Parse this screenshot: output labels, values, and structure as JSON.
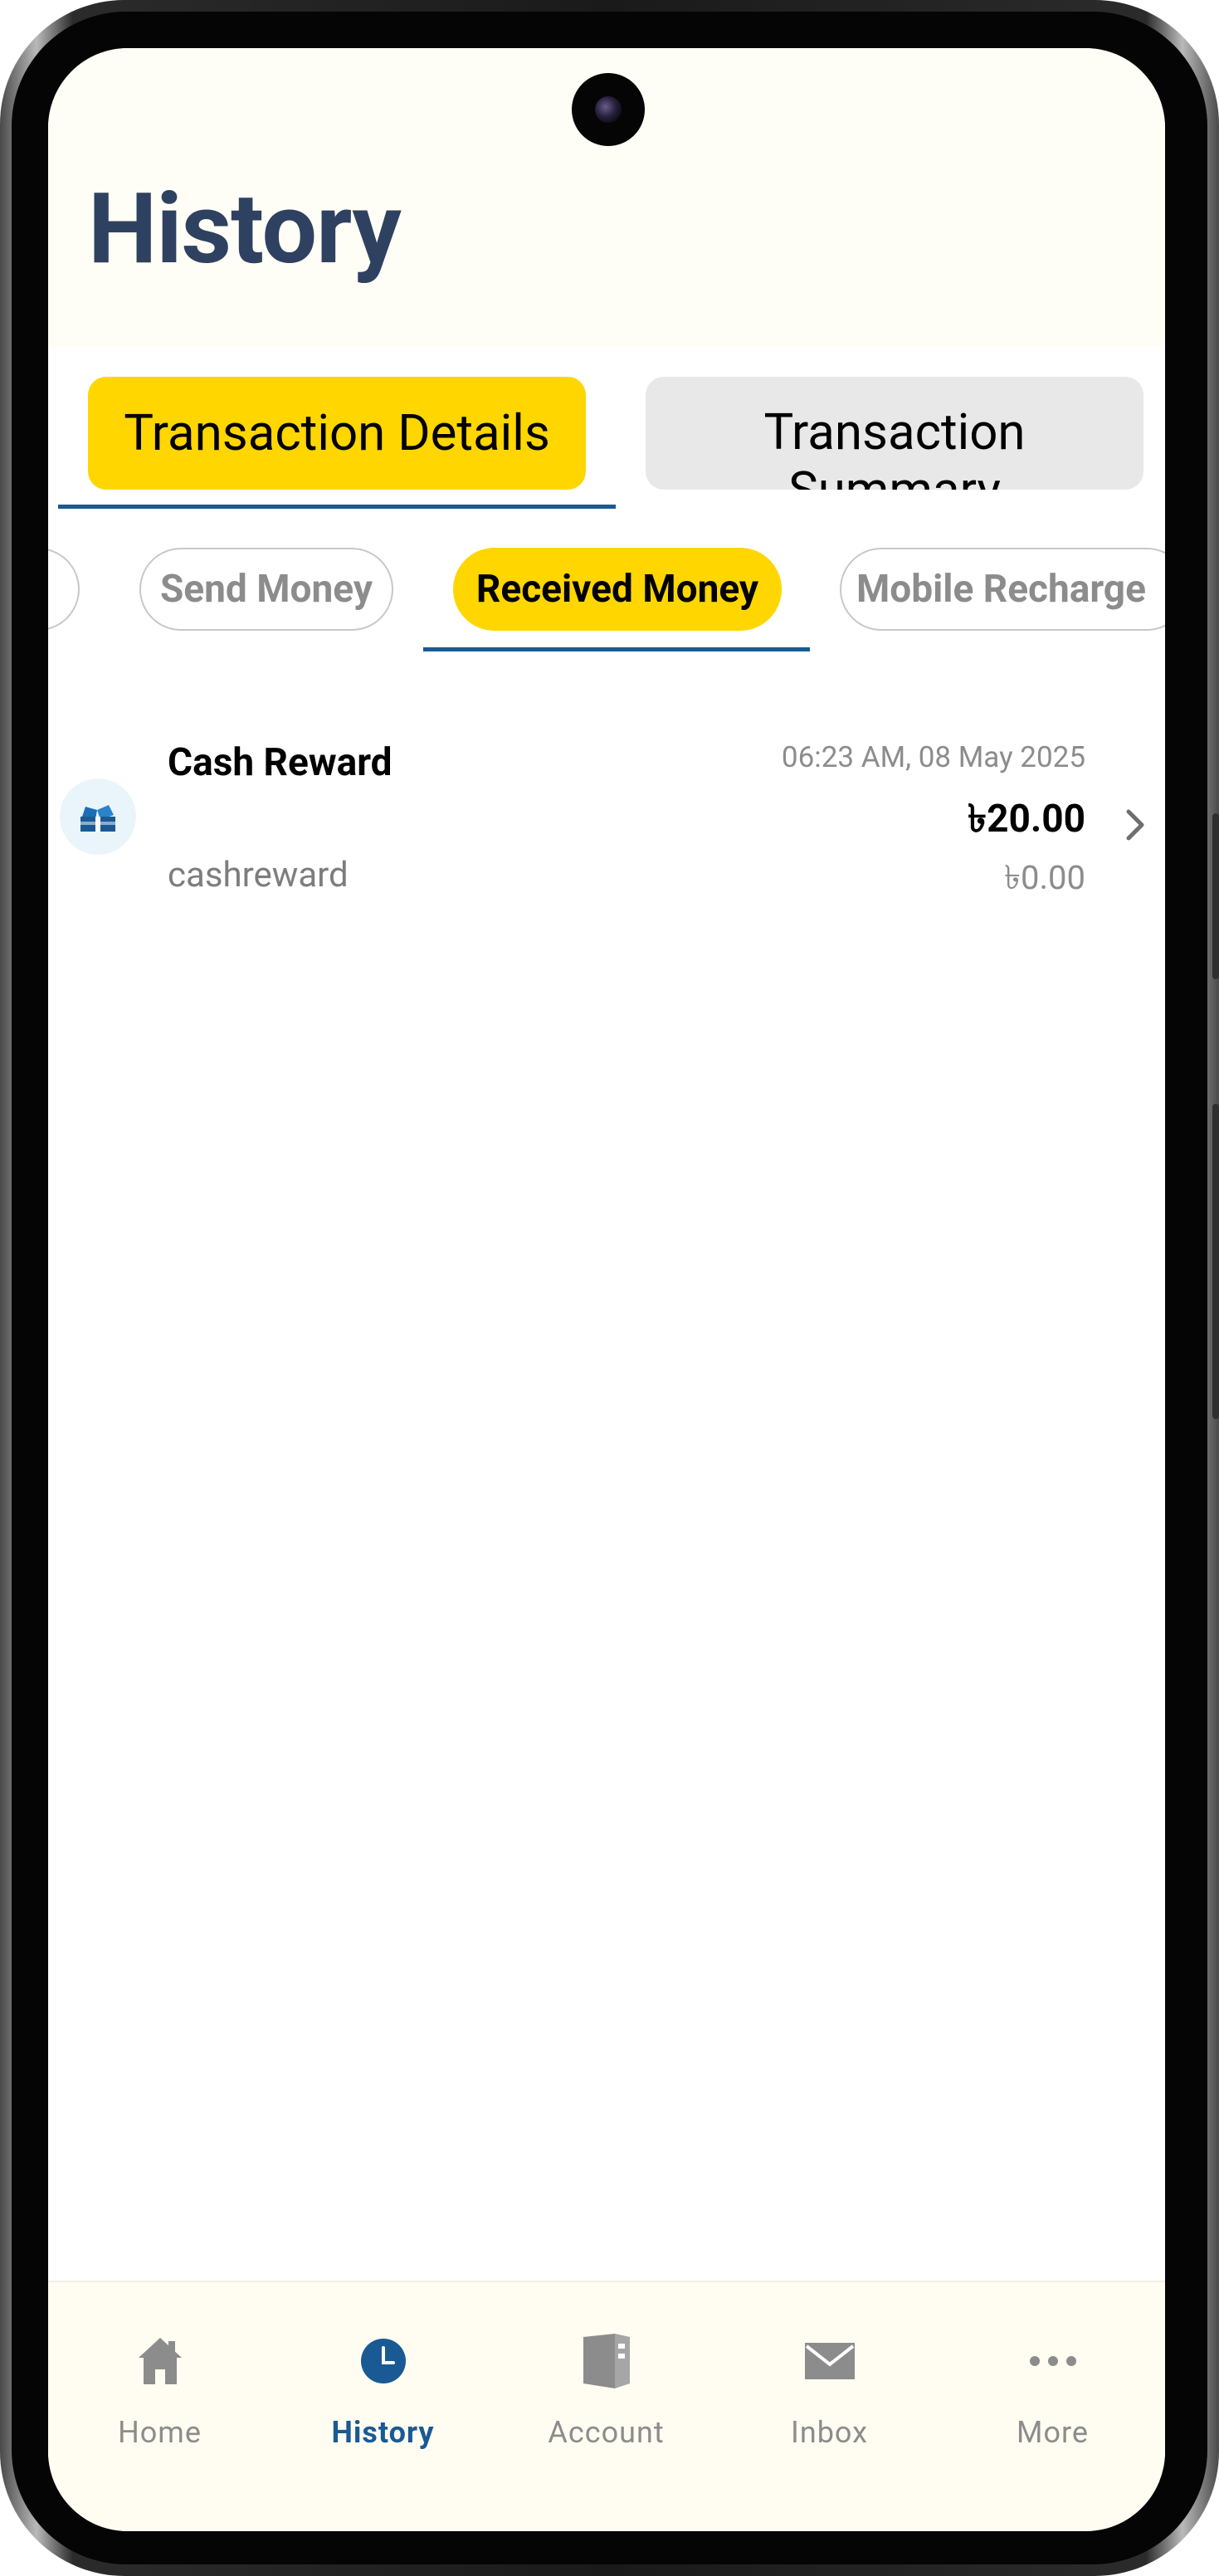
{
  "page": {
    "title": "History"
  },
  "tabs": [
    {
      "label": "Transaction Details",
      "active": true
    },
    {
      "label": "Transaction Summary",
      "active": false
    }
  ],
  "filters": [
    {
      "label": "",
      "active": false
    },
    {
      "label": "Send Money",
      "active": false
    },
    {
      "label": "Received Money",
      "active": true
    },
    {
      "label": "Mobile Recharge",
      "active": false
    }
  ],
  "transactions": [
    {
      "title": "Cash Reward",
      "subtitle": "cashreward",
      "datetime": "06:23 AM, 08 May 2025",
      "amount": "৳20.00",
      "fee": "৳0.00",
      "icon": "gift-box-icon"
    }
  ],
  "bottom_nav": [
    {
      "label": "Home",
      "icon": "home-icon",
      "active": false
    },
    {
      "label": "History",
      "icon": "clock-icon",
      "active": true
    },
    {
      "label": "Account",
      "icon": "account-book-icon",
      "active": false
    },
    {
      "label": "Inbox",
      "icon": "envelope-icon",
      "active": false
    },
    {
      "label": "More",
      "icon": "more-dots-icon",
      "active": false
    }
  ],
  "colors": {
    "accent_yellow": "#ffd600",
    "primary_blue": "#1a5a94",
    "title_navy": "#2f4160",
    "header_bg": "#fffef6"
  }
}
